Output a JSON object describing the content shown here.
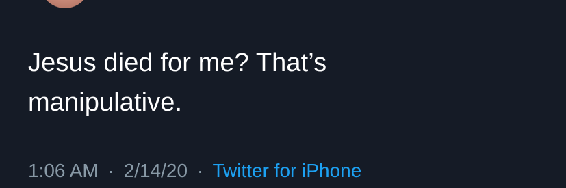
{
  "tweet": {
    "text_lines": [
      "Jesus died for me? That’s",
      "manipulative."
    ],
    "time": "1:06 AM",
    "separator": "·",
    "date": "2/14/20",
    "source": "Twitter for iPhone"
  },
  "colors": {
    "background": "#151b26",
    "text": "#ffffff",
    "meta": "#8899a6",
    "link": "#1da1f2"
  }
}
